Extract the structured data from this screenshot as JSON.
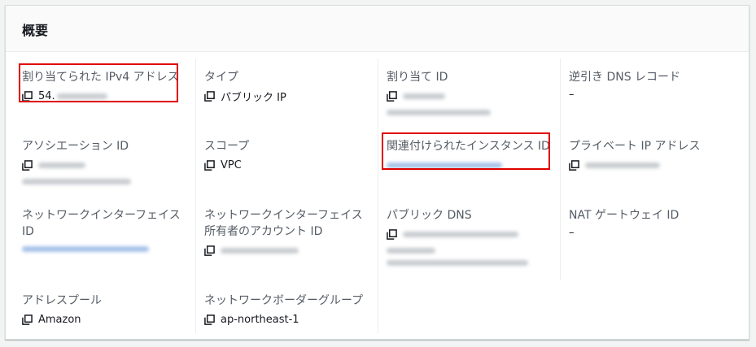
{
  "panel": {
    "title": "概要"
  },
  "fields": {
    "ipv4": {
      "label": "割り当てられた IPv4 アドレス",
      "value": "54."
    },
    "type": {
      "label": "タイプ",
      "value": "パブリック IP"
    },
    "alloc": {
      "label": "割り当て ID"
    },
    "rdns": {
      "label": "逆引き DNS レコード",
      "value": "–"
    },
    "assoc": {
      "label": "アソシエーション ID"
    },
    "scope": {
      "label": "スコープ",
      "value": "VPC"
    },
    "instance": {
      "label": "関連付けられたインスタンス ID"
    },
    "privip": {
      "label": "プライベート IP アドレス"
    },
    "eni": {
      "label": "ネットワークインターフェイス ID"
    },
    "eniowner": {
      "label": "ネットワークインターフェイス所有者のアカウント ID"
    },
    "pubdns": {
      "label": "パブリック DNS"
    },
    "natgw": {
      "label": "NAT ゲートウェイ ID",
      "value": "–"
    },
    "pool": {
      "label": "アドレスプール",
      "value": "Amazon"
    },
    "border": {
      "label": "ネットワークボーダーグループ",
      "value": "ap-northeast-1"
    }
  },
  "icons": {
    "copy": "copy-icon"
  },
  "colors": {
    "highlight": "#e00000",
    "link_blur": "#a6c2e8"
  }
}
